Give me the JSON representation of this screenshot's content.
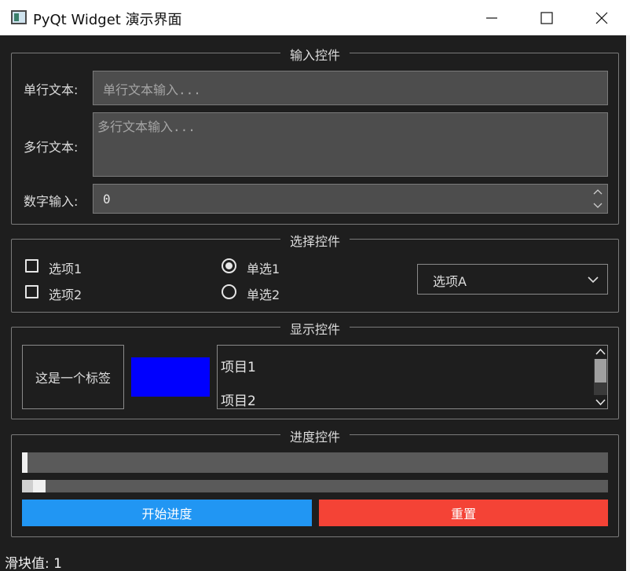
{
  "window": {
    "title": "PyQt Widget 演示界面",
    "icon": "app-window-icon"
  },
  "window_buttons": {
    "minimize": "minimize-icon",
    "maximize": "maximize-icon",
    "close": "close-icon"
  },
  "input_group": {
    "title": "输入控件",
    "single_line_label": "单行文本:",
    "single_line_placeholder": "单行文本输入...",
    "multi_line_label": "多行文本:",
    "multi_line_placeholder": "多行文本输入...",
    "number_label": "数字输入:",
    "number_value": "0"
  },
  "select_group": {
    "title": "选择控件",
    "checkboxes": [
      {
        "label": "选项1",
        "checked": false
      },
      {
        "label": "选项2",
        "checked": false
      }
    ],
    "radios": [
      {
        "label": "单选1",
        "checked": true
      },
      {
        "label": "单选2",
        "checked": false
      }
    ],
    "combo_value": "选项A"
  },
  "display_group": {
    "title": "显示控件",
    "label_text": "这是一个标签",
    "color_swatch": "#0000ff",
    "list_items": [
      "项目1",
      "项目2"
    ]
  },
  "progress_group": {
    "title": "进度控件",
    "progress_value": 1,
    "slider_value": 1,
    "start_button": "开始进度",
    "reset_button": "重置",
    "start_color": "#2196f3",
    "reset_color": "#f44336"
  },
  "status": {
    "slider_value_text": "滑块值: 1"
  }
}
